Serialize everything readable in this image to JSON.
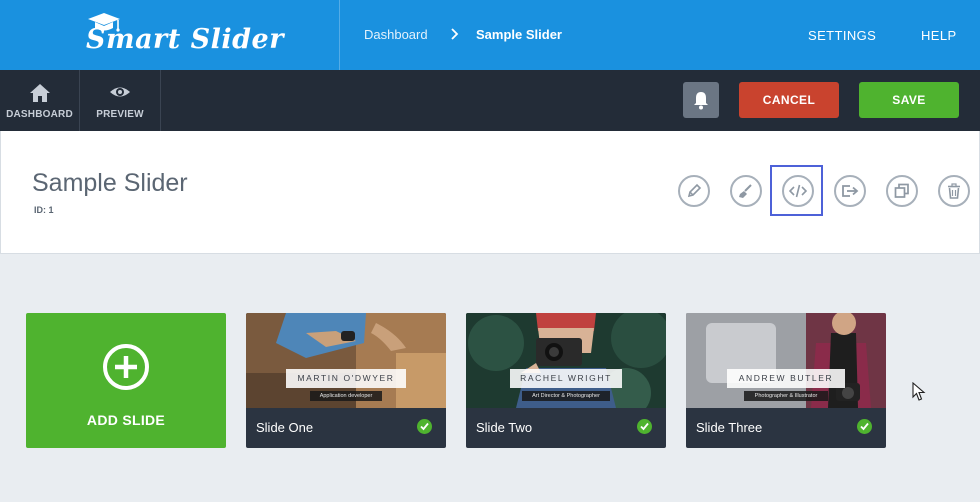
{
  "app": {
    "logo_text": "Smart Slider"
  },
  "breadcrumb": {
    "items": [
      "Dashboard",
      "Sample Slider"
    ]
  },
  "topnav": {
    "settings": "SETTINGS",
    "help": "HELP"
  },
  "toolbar": {
    "dashboard_label": "DASHBOARD",
    "preview_label": "PREVIEW",
    "cancel_label": "CANCEL",
    "save_label": "SAVE"
  },
  "slider": {
    "title": "Sample Slider",
    "id_text": "ID: 1",
    "actions": [
      "edit-icon",
      "brush-icon",
      "code-icon",
      "export-icon",
      "duplicate-icon",
      "trash-icon"
    ]
  },
  "add_slide": {
    "label": "ADD SLIDE"
  },
  "slides": [
    {
      "title": "Slide One",
      "name": "MARTIN O'DWYER",
      "role": "Application developer",
      "published": true
    },
    {
      "title": "Slide Two",
      "name": "RACHEL WRIGHT",
      "role": "Art Director & Photographer",
      "published": true
    },
    {
      "title": "Slide Three",
      "name": "ANDREW BUTLER",
      "role": "Photographer & Illustrator",
      "published": true
    }
  ],
  "colors": {
    "brand_blue": "#1a91df",
    "toolbar_dark": "#232c38",
    "cancel_red": "#c9432e",
    "save_green": "#4fb32f",
    "focus_outline": "#4d61d8"
  }
}
